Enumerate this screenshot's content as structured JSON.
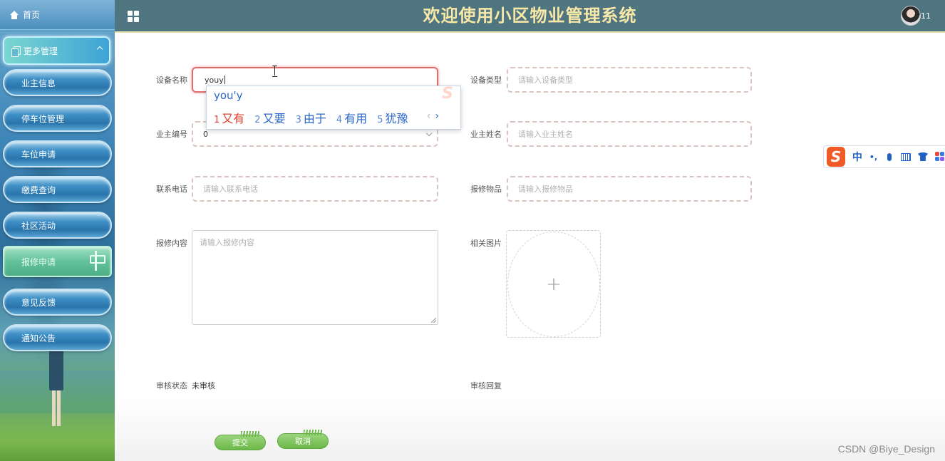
{
  "app": {
    "title": "欢迎使用小区物业管理系统",
    "user_name": "11"
  },
  "sidebar": {
    "home_label": "首页",
    "group_label": "更多管理",
    "items": [
      {
        "label": "业主信息",
        "active": false
      },
      {
        "label": "停车位管理",
        "active": false
      },
      {
        "label": "车位申请",
        "active": false
      },
      {
        "label": "缴费查询",
        "active": false
      },
      {
        "label": "社区活动",
        "active": false
      },
      {
        "label": "报修申请",
        "active": true
      },
      {
        "label": "意见反馈",
        "active": false
      },
      {
        "label": "通知公告",
        "active": false
      }
    ]
  },
  "form": {
    "device_name": {
      "label": "设备名称",
      "value": "youy"
    },
    "device_type": {
      "label": "设备类型",
      "placeholder": "请输入设备类型"
    },
    "owner_id": {
      "label": "业主编号",
      "value": "0"
    },
    "owner_name": {
      "label": "业主姓名",
      "placeholder": "请输入业主姓名"
    },
    "phone": {
      "label": "联系电话",
      "placeholder": "请输入联系电话"
    },
    "repair_item": {
      "label": "报修物品",
      "placeholder": "请输入报修物品"
    },
    "repair_content": {
      "label": "报修内容",
      "placeholder": "请输入报修内容"
    },
    "related_image": {
      "label": "相关图片",
      "upload_symbol": "+"
    },
    "review_status": {
      "label": "审核状态",
      "value": "未审核"
    },
    "review_reply": {
      "label": "审核回复",
      "value": ""
    },
    "submit_label": "提交",
    "cancel_label": "取消"
  },
  "ime": {
    "pinyin": "you'y",
    "candidates": [
      {
        "num": "1",
        "text": "又有"
      },
      {
        "num": "2",
        "text": "又要"
      },
      {
        "num": "3",
        "text": "由于"
      },
      {
        "num": "4",
        "text": "有用"
      },
      {
        "num": "5",
        "text": "犹豫"
      }
    ],
    "prev": "‹",
    "next": "›",
    "toolbar": {
      "logo": "S",
      "mode": "中",
      "punct": "•,"
    }
  },
  "colors": {
    "header_bg": "#4f7580",
    "title_color": "#f7e8a8",
    "focus_border": "#e06c6c",
    "button_green": "#6cb84a",
    "ime_blue": "#2a66c8",
    "ime_red": "#e0402f"
  },
  "icons": [
    "home-icon",
    "grid-icon",
    "copy-icon",
    "chevron-up-icon",
    "signpost-icon",
    "plus-icon",
    "sogou-logo-icon",
    "mic-icon",
    "keyboard-icon",
    "skin-icon",
    "apps-icon"
  ],
  "watermark": "CSDN @Biye_Design"
}
